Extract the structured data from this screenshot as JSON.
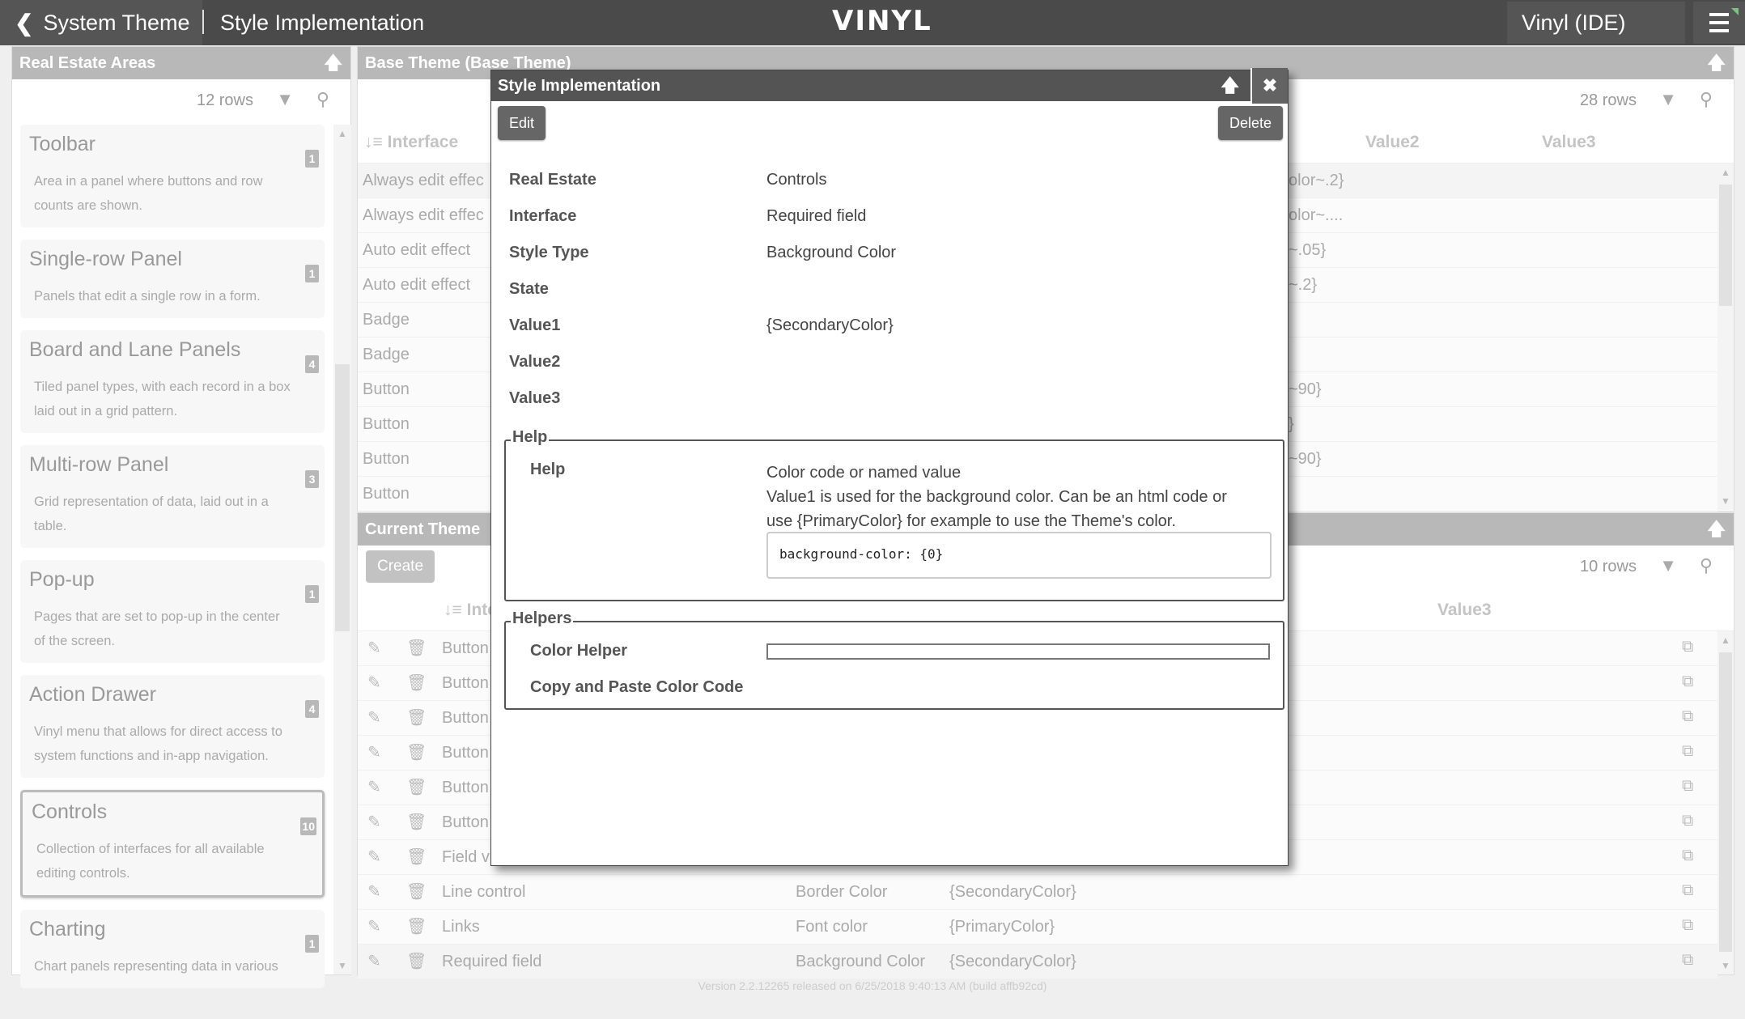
{
  "topbar": {
    "back_label": "System Theme",
    "page_title": "Style Implementation",
    "logo": "VINYL",
    "app_name": "Vinyl (IDE)",
    "back_icon": "chevron-left-icon",
    "menu_icon": "hamburger-menu-icon"
  },
  "real_estate": {
    "title": "Real Estate Areas",
    "row_count": "12 rows",
    "cards": [
      {
        "title": "Toolbar",
        "desc": "Area in a panel where buttons and row counts are shown.",
        "badge": "1"
      },
      {
        "title": "Single-row Panel",
        "desc": "Panels that edit a single row in a form.",
        "badge": "1"
      },
      {
        "title": "Board and Lane Panels",
        "desc": "Tiled panel types, with each record in a box laid out in a grid pattern.",
        "badge": "4"
      },
      {
        "title": "Multi-row Panel",
        "desc": "Grid representation of data, laid out in a table.",
        "badge": "3"
      },
      {
        "title": "Pop-up",
        "desc": "Pages that are set to pop-up in the center of the screen.",
        "badge": "1"
      },
      {
        "title": "Action Drawer",
        "desc": "Vinyl menu that allows for direct access to system functions and in-app navigation.",
        "badge": "4"
      },
      {
        "title": "Controls",
        "desc": "Collection of interfaces for all available editing controls.",
        "badge": "10",
        "selected": true
      },
      {
        "title": "Charting",
        "desc": "Chart panels representing data in various",
        "badge": "1"
      }
    ]
  },
  "base_theme": {
    "title": "Base Theme (Base Theme)",
    "row_count": "28 rows",
    "columns": [
      "Interface",
      "Value2",
      "Value3"
    ],
    "rows": [
      {
        "interface": "Always edit effec",
        "value1_tail": "olor~.2}"
      },
      {
        "interface": "Always edit effec",
        "value1_tail": "olor~...."
      },
      {
        "interface": "Auto edit effect",
        "value1_tail": "~.05}"
      },
      {
        "interface": "Auto edit effect",
        "value1_tail": "~.2}"
      },
      {
        "interface": "Badge",
        "value1_tail": ""
      },
      {
        "interface": "Badge",
        "value1_tail": ""
      },
      {
        "interface": "Button",
        "value1_tail": "~90}"
      },
      {
        "interface": "Button",
        "value1_tail": "}"
      },
      {
        "interface": "Button",
        "value1_tail": "~90}"
      },
      {
        "interface": "Button",
        "value1_tail": ""
      }
    ]
  },
  "current_theme": {
    "title": "Current Theme",
    "create_label": "Create",
    "row_count": "10 rows",
    "columns": [
      "Inte",
      "Value3"
    ],
    "rows": [
      {
        "interface": "Button",
        "style_type": "",
        "value1": ""
      },
      {
        "interface": "Button",
        "style_type": "",
        "value1": ""
      },
      {
        "interface": "Button",
        "style_type": "",
        "value1": ""
      },
      {
        "interface": "Button",
        "style_type": "",
        "value1": ""
      },
      {
        "interface": "Button",
        "style_type": "",
        "value1": ""
      },
      {
        "interface": "Button",
        "style_type": "",
        "value1": ""
      },
      {
        "interface": "Field v",
        "style_type": "",
        "value1": ""
      },
      {
        "interface": "Line control",
        "style_type": "Border Color",
        "value1": "{SecondaryColor}"
      },
      {
        "interface": "Links",
        "style_type": "Font color",
        "value1": "{PrimaryColor}"
      },
      {
        "interface": "Required field",
        "style_type": "Background Color",
        "value1": "{SecondaryColor}"
      }
    ]
  },
  "dialog": {
    "title": "Style Implementation",
    "edit_label": "Edit",
    "delete_label": "Delete",
    "fields": [
      {
        "label": "Real Estate",
        "value": "Controls"
      },
      {
        "label": "Interface",
        "value": "Required field"
      },
      {
        "label": "Style Type",
        "value": "Background Color"
      },
      {
        "label": "State",
        "value": ""
      },
      {
        "label": "Value1",
        "value": "{SecondaryColor}"
      },
      {
        "label": "Value2",
        "value": ""
      },
      {
        "label": "Value3",
        "value": ""
      }
    ],
    "help_section": {
      "legend": "Help",
      "label": "Help",
      "line1": "Color code or named value",
      "line2": "Value1 is used for the background color. Can be an html code or",
      "line3": "use {PrimaryColor} for example to use the Theme's color.",
      "code": "background-color: {0}"
    },
    "helpers_section": {
      "legend": "Helpers",
      "color_helper_label": "Color Helper",
      "color_helper_value": "",
      "copy_paste_label": "Copy and Paste Color Code"
    }
  },
  "footer": {
    "version": "Version 2.2.12265 released on 6/25/2018 9:40:13 AM (build affb92cd)"
  },
  "colors": {
    "topbar": "#4a4a4a",
    "panel_header": "#b8b8b8",
    "dialog_title": "#545454",
    "button": "#666666",
    "menu_accent": "#7ec27e"
  }
}
